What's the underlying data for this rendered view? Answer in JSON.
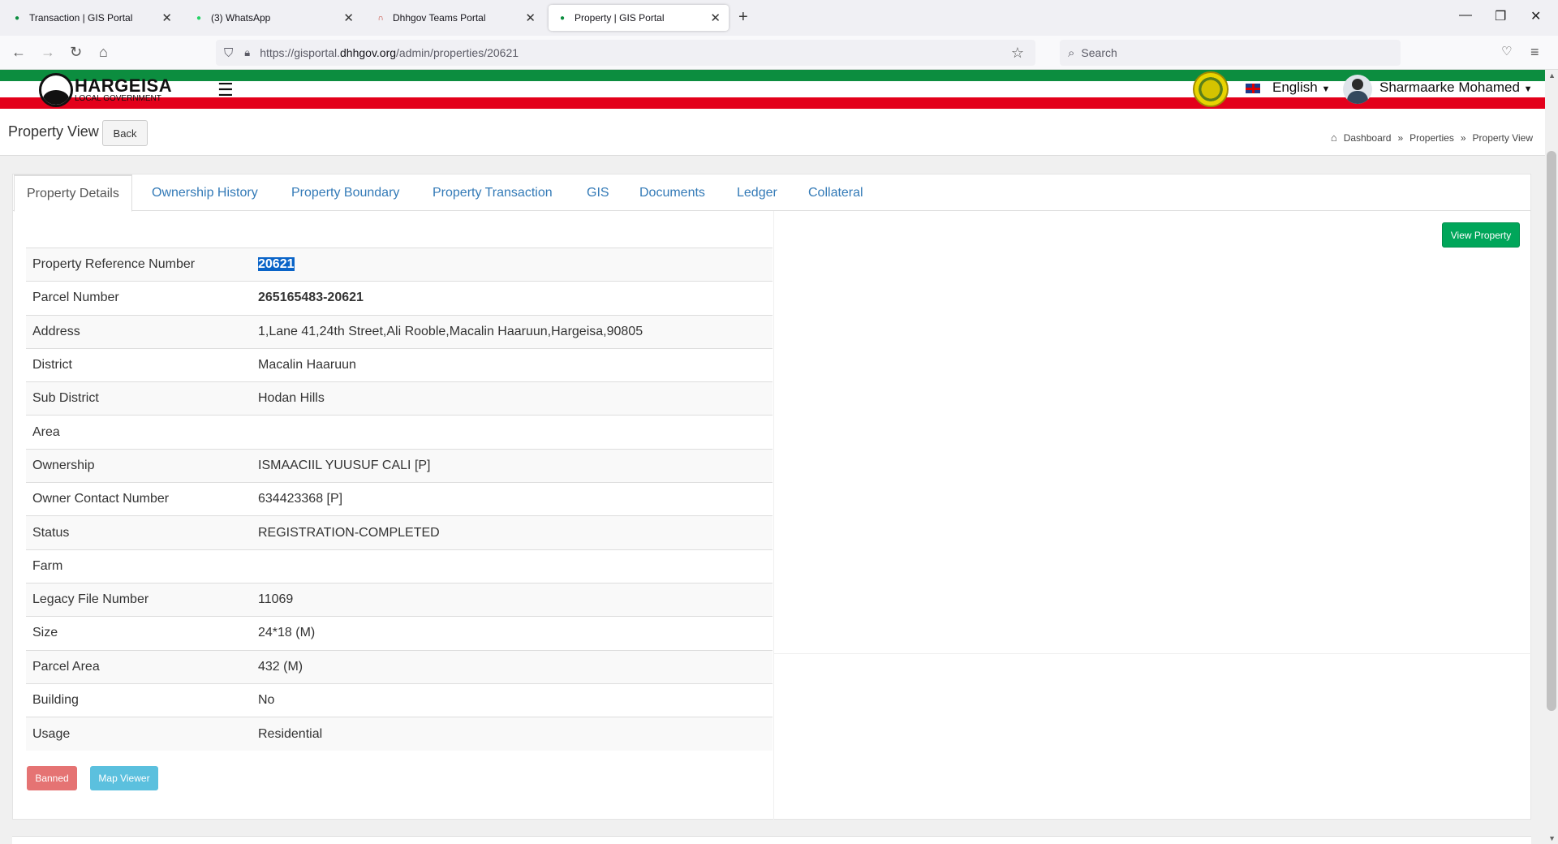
{
  "browser": {
    "tabs": [
      {
        "title": "Transaction | GIS Portal"
      },
      {
        "title": "(3) WhatsApp"
      },
      {
        "title": "Dhhgov Teams Portal"
      },
      {
        "title": "Property | GIS Portal"
      }
    ],
    "url_prefix": "https://gisportal.",
    "url_domain": "dhhgov.org",
    "url_path": "/admin/properties/20621",
    "search_placeholder": "Search"
  },
  "header": {
    "logo_title": "HARGEISA",
    "logo_subtitle": "LOCAL GOVERNMENT",
    "language": "English",
    "user_name": "Sharmaarke Mohamed"
  },
  "page": {
    "title": "Property View",
    "back_label": "Back",
    "breadcrumb": [
      "Dashboard",
      "Properties",
      "Property View"
    ],
    "breadcrumb_sep": "»"
  },
  "tabs": [
    "Property Details",
    "Ownership History",
    "Property Boundary",
    "Property Transaction",
    "GIS",
    "Documents",
    "Ledger",
    "Collateral"
  ],
  "view_property_label": "View Property",
  "details": [
    {
      "label": "Property Reference Number",
      "value": "20621"
    },
    {
      "label": "Parcel Number",
      "value": "265165483-20621"
    },
    {
      "label": "Address",
      "value": "1,Lane 41,24th Street,Ali Rooble,Macalin Haaruun,Hargeisa,90805"
    },
    {
      "label": "District",
      "value": "Macalin Haaruun"
    },
    {
      "label": "Sub District",
      "value": "Hodan Hills"
    },
    {
      "label": "Area",
      "value": ""
    },
    {
      "label": "Ownership",
      "value": "ISMAACIIL YUUSUF CALI [P]"
    },
    {
      "label": "Owner Contact Number",
      "value": "634423368 [P]"
    },
    {
      "label": "Status",
      "value": "REGISTRATION-COMPLETED"
    },
    {
      "label": "Farm",
      "value": ""
    },
    {
      "label": "Legacy File Number",
      "value": "11069"
    },
    {
      "label": "Size",
      "value": "24*18 (M)"
    },
    {
      "label": "Parcel Area",
      "value": "432 (M)"
    },
    {
      "label": "Building",
      "value": "No"
    },
    {
      "label": "Usage",
      "value": "Residential"
    }
  ],
  "actions": {
    "banned_label": "Banned",
    "map_viewer_label": "Map Viewer"
  },
  "colors": {
    "flag_green": "#0c8d3f",
    "flag_red": "#e3001b",
    "link_blue": "#337ab7",
    "success": "#00a65a",
    "danger": "#e57373",
    "info": "#5bc0de"
  }
}
